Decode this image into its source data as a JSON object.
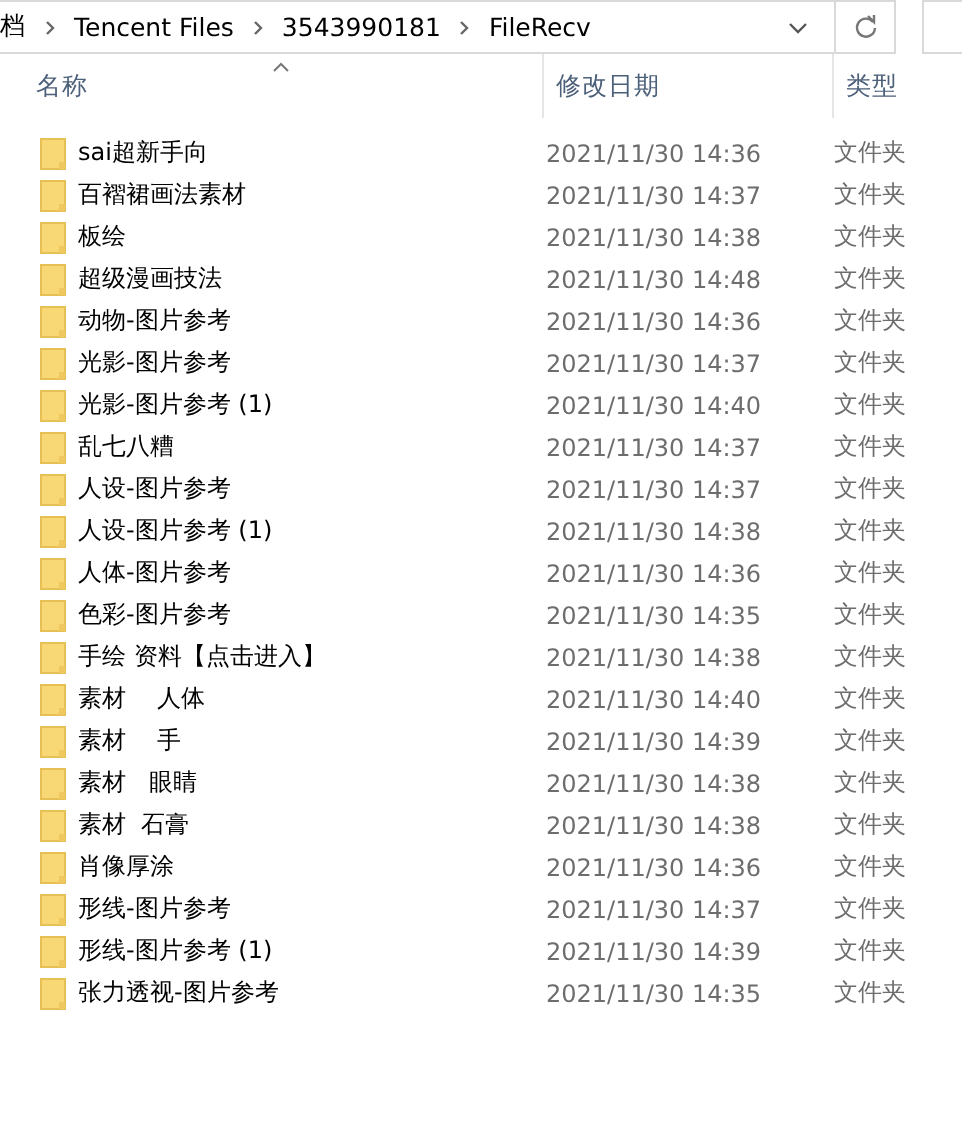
{
  "address_bar": {
    "path": [
      "档",
      "Tencent Files",
      "3543990181",
      "FileRecv"
    ]
  },
  "columns": [
    {
      "label": "名称",
      "sorted": true
    },
    {
      "label": "修改日期",
      "sorted": false
    },
    {
      "label": "类型",
      "sorted": false
    }
  ],
  "rows": [
    {
      "name": "sai超新手向",
      "date": "2021/11/30 14:36",
      "type": "文件夹"
    },
    {
      "name": "百褶裙画法素材",
      "date": "2021/11/30 14:37",
      "type": "文件夹"
    },
    {
      "name": "板绘",
      "date": "2021/11/30 14:38",
      "type": "文件夹"
    },
    {
      "name": "超级漫画技法",
      "date": "2021/11/30 14:48",
      "type": "文件夹"
    },
    {
      "name": "动物-图片参考",
      "date": "2021/11/30 14:36",
      "type": "文件夹"
    },
    {
      "name": "光影-图片参考",
      "date": "2021/11/30 14:37",
      "type": "文件夹"
    },
    {
      "name": "光影-图片参考 (1)",
      "date": "2021/11/30 14:40",
      "type": "文件夹"
    },
    {
      "name": "乱七八糟",
      "date": "2021/11/30 14:37",
      "type": "文件夹"
    },
    {
      "name": "人设-图片参考",
      "date": "2021/11/30 14:37",
      "type": "文件夹"
    },
    {
      "name": "人设-图片参考 (1)",
      "date": "2021/11/30 14:38",
      "type": "文件夹"
    },
    {
      "name": "人体-图片参考",
      "date": "2021/11/30 14:36",
      "type": "文件夹"
    },
    {
      "name": "色彩-图片参考",
      "date": "2021/11/30 14:35",
      "type": "文件夹"
    },
    {
      "name": "手绘 资料【点击进入】",
      "date": "2021/11/30 14:38",
      "type": "文件夹"
    },
    {
      "name": "素材    人体",
      "date": "2021/11/30 14:40",
      "type": "文件夹"
    },
    {
      "name": "素材    手",
      "date": "2021/11/30 14:39",
      "type": "文件夹"
    },
    {
      "name": "素材   眼睛",
      "date": "2021/11/30 14:38",
      "type": "文件夹"
    },
    {
      "name": "素材  石膏",
      "date": "2021/11/30 14:38",
      "type": "文件夹"
    },
    {
      "name": "肖像厚涂",
      "date": "2021/11/30 14:36",
      "type": "文件夹"
    },
    {
      "name": "形线-图片参考",
      "date": "2021/11/30 14:37",
      "type": "文件夹"
    },
    {
      "name": "形线-图片参考 (1)",
      "date": "2021/11/30 14:39",
      "type": "文件夹"
    },
    {
      "name": "张力透视-图片参考",
      "date": "2021/11/30 14:35",
      "type": "文件夹"
    }
  ]
}
